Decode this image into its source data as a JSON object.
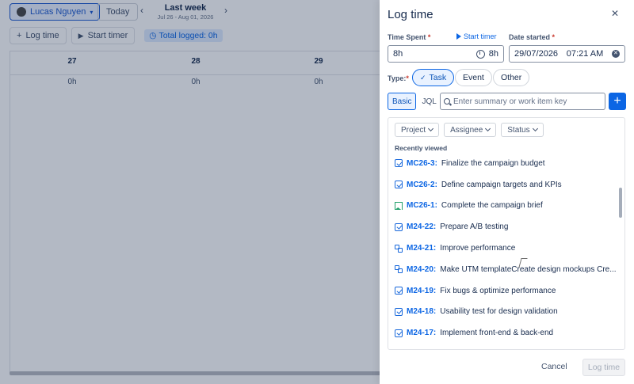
{
  "background": {
    "user_name": "Lucas Nguyen",
    "today_label": "Today",
    "week_title": "Last week",
    "week_range": "Jul 26 - Aug 01, 2026",
    "toolbar": {
      "log_time": "Log time",
      "start_timer": "Start timer",
      "total_logged": "Total logged: 0h"
    },
    "days": [
      {
        "num": "27",
        "total": "0h"
      },
      {
        "num": "28",
        "total": "0h"
      },
      {
        "num": "29",
        "total": "0h"
      }
    ]
  },
  "drawer": {
    "title": "Log time",
    "time_spent_label": "Time Spent",
    "time_spent_value": "8h",
    "time_spent_suffix": "8h",
    "start_timer": "Start timer",
    "date_started_label": "Date started",
    "date_value": "29/07/2026",
    "time_value": "07:21 AM",
    "type_label": "Type:",
    "types": [
      {
        "label": "Task",
        "selected": true
      },
      {
        "label": "Event",
        "selected": false
      },
      {
        "label": "Other",
        "selected": false
      }
    ],
    "search_modes": {
      "basic": "Basic",
      "jql": "JQL"
    },
    "search_placeholder": "Enter summary or work item key",
    "filters": [
      "Project",
      "Assignee",
      "Status"
    ],
    "recently_viewed": "Recently viewed",
    "items": [
      {
        "key": "MC26-3:",
        "title": "Finalize the campaign budget",
        "icon": "task-check-icon"
      },
      {
        "key": "MC26-2:",
        "title": "Define campaign targets and KPIs",
        "icon": "task-check-icon"
      },
      {
        "key": "MC26-1:",
        "title": "Complete the campaign brief",
        "icon": "story-bookmark-icon"
      },
      {
        "key": "M24-22:",
        "title": "Prepare A/B testing",
        "icon": "task-check-icon"
      },
      {
        "key": "M24-21:",
        "title": "Improve performance",
        "icon": "subtask-icon"
      },
      {
        "key": "M24-20:",
        "title": "Make UTM templateCreate design mockups Cre...",
        "icon": "subtask-icon"
      },
      {
        "key": "M24-19:",
        "title": "Fix bugs & optimize performance",
        "icon": "task-check-icon"
      },
      {
        "key": "M24-18:",
        "title": "Usability test for design validation",
        "icon": "task-check-icon"
      },
      {
        "key": "M24-17:",
        "title": "Implement front-end & back-end",
        "icon": "task-check-icon"
      }
    ],
    "cancel": "Cancel",
    "submit": "Log time"
  },
  "colors": {
    "accent": "#0c66e4",
    "required": "#c9372c",
    "story_green": "#22a06b",
    "overlay": "rgba(9,30,66,0.31)"
  }
}
